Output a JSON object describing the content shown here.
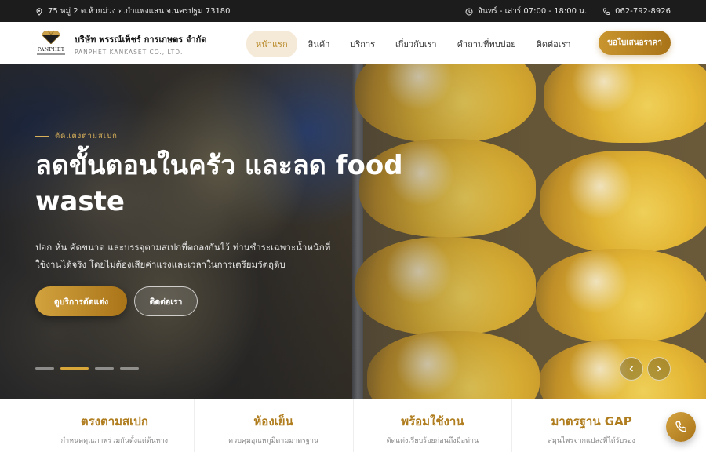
{
  "topbar": {
    "address": "75 หมู่ 2 ต.ห้วยม่วง อ.กำแพงแสน จ.นครปฐม 73180",
    "hours": "จันทร์ - เสาร์ 07:00 - 18:00 น.",
    "phone": "062-792-8926"
  },
  "brand": {
    "logo_word": "PANPHET",
    "name_th": "บริษัท พรรณ์เพ็ชร์ การเกษตร จำกัด",
    "name_en": "PANPHET KANKASET CO., LTD."
  },
  "nav": {
    "items": [
      "หน้าแรก",
      "สินค้า",
      "บริการ",
      "เกี่ยวกับเรา",
      "คำถามที่พบบ่อย",
      "ติดต่อเรา"
    ],
    "active": "หน้าแรก"
  },
  "cta_label": "ขอใบเสนอราคา",
  "hero": {
    "eyebrow": "ตัดแต่งตามสเปก",
    "headline": "ลดขั้นตอนในครัว และลด food waste",
    "lead": "ปอก หั่น คัดขนาด และบรรจุตามสเปกที่ตกลงกันไว้ ท่านชำระเฉพาะน้ำหนักที่ใช้งานได้จริง โดยไม่ต้องเสียค่าแรงและเวลาในการเตรียมวัตถุดิบ",
    "primary_button": "ดูบริการตัดแต่ง",
    "secondary_button": "ติดต่อเรา",
    "slides_total": 4,
    "slide_active": 2
  },
  "features": [
    {
      "title": "ตรงตามสเปก",
      "subtitle": "กำหนดคุณภาพร่วมกันตั้งแต่ต้นทาง"
    },
    {
      "title": "ห้องเย็น",
      "subtitle": "ควบคุมอุณหภูมิตามมาตรฐาน"
    },
    {
      "title": "พร้อมใช้งาน",
      "subtitle": "ตัดแต่งเรียบร้อยก่อนถึงมือท่าน"
    },
    {
      "title": "มาตรฐาน GAP",
      "subtitle": "สมุนไพรจากแปลงที่ได้รับรอง"
    }
  ],
  "colors": {
    "accent": "#b07d1e",
    "accent_light": "#d9a63a",
    "topbar_bg": "#1c1c1c",
    "nav_active_bg": "#f5ead8"
  },
  "icons": [
    "location-pin-icon",
    "clock-icon",
    "phone-icon",
    "chevron-left-icon",
    "chevron-right-icon",
    "phone-icon"
  ]
}
